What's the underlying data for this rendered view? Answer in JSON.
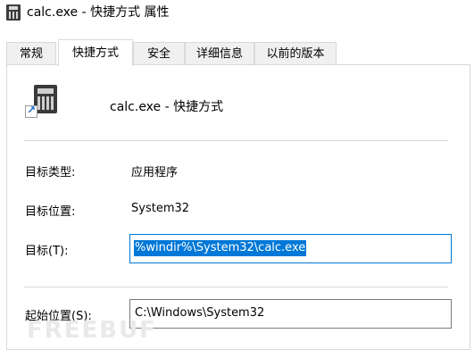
{
  "window": {
    "title": "calc.exe - 快捷方式 属性"
  },
  "tabs": [
    {
      "label": "常规"
    },
    {
      "label": "快捷方式"
    },
    {
      "label": "安全"
    },
    {
      "label": "详细信息"
    },
    {
      "label": "以前的版本"
    }
  ],
  "shortcut": {
    "name": "calc.exe - 快捷方式"
  },
  "fields": {
    "target_type": {
      "label": "目标类型:",
      "value": "应用程序"
    },
    "target_location": {
      "label": "目标位置:",
      "value": "System32"
    },
    "target": {
      "label": "目标(T):",
      "value": "%windir%\\System32\\calc.exe"
    },
    "start_in": {
      "label": "起始位置(S):",
      "value": "C:\\Windows\\System32"
    }
  },
  "watermark": "FREEBUF"
}
